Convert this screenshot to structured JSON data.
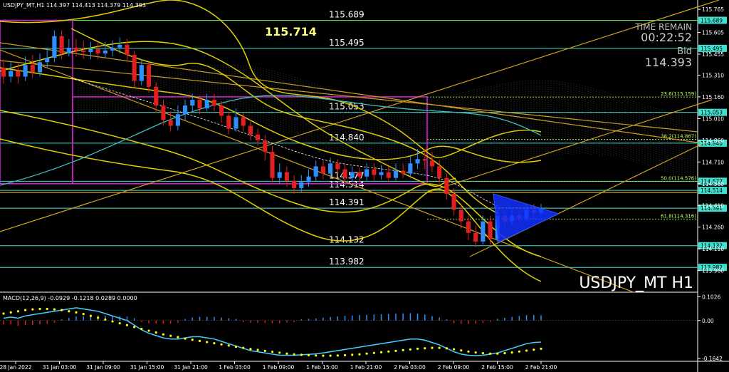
{
  "symbol_header": "USDJPY_MT,H1  114.397 114.413 114.379 114.393",
  "big_price": "115.714",
  "time_remain_label": "TIME REMAIN",
  "time_remain_value": "00:22:52",
  "bid_label": "Bid",
  "bid_value": "114.393",
  "watermark": "USDJPY_MT H1",
  "macd_header": "MACD(12,26,9) -0.0929 -0.1218 0.0289 0.0000",
  "colors": {
    "bull": "#2f8fff",
    "bear": "#e02020",
    "trend": "#e0c000",
    "level": "#40e0d0",
    "green_level": "#40ff40",
    "rect": "#e020e0",
    "signal": "#ffff00",
    "macd_line": "#40d0ff"
  },
  "chart_data": [
    {
      "type": "candlestick",
      "title": "USDJPY_MT,H1",
      "ylim": [
        113.85,
        115.78
      ],
      "y_ticks": [
        "115.765",
        "115.605",
        "115.455",
        "115.310",
        "115.160",
        "115.010",
        "114.860",
        "114.710",
        "114.560",
        "114.410",
        "114.260",
        "114.110",
        "113.960"
      ],
      "x_ticks": [
        "28 Jan 2022",
        "31 Jan 03:00",
        "31 Jan 09:00",
        "31 Jan 15:00",
        "31 Jan 21:00",
        "1 Feb 03:00",
        "1 Feb 09:00",
        "1 Feb 15:00",
        "1 Feb 21:00",
        "2 Feb 03:00",
        "2 Feb 09:00",
        "2 Feb 15:00",
        "2 Feb 21:00"
      ],
      "levels": [
        {
          "value": 115.689,
          "label": "115.689",
          "tag": "115.689"
        },
        {
          "value": 115.495,
          "label": "115.495",
          "tag": "115.495"
        },
        {
          "value": 115.053,
          "label": "115.053",
          "tag": "115.053"
        },
        {
          "value": 114.84,
          "label": "114.840",
          "tag": "114.840"
        },
        {
          "value": 114.577,
          "label": "114.577",
          "tag": "114.577"
        },
        {
          "value": 114.514,
          "label": "114.514",
          "tag": "114.514"
        },
        {
          "value": 114.391,
          "label": "114.391",
          "tag": "114.391"
        },
        {
          "value": 114.132,
          "label": "114.132",
          "tag": "114.132"
        },
        {
          "value": 113.982,
          "label": "113.982",
          "tag": "113.982"
        }
      ],
      "fibo": [
        {
          "value": 115.159,
          "label": "23.6(115.159)"
        },
        {
          "value": 114.867,
          "label": "38.2(114.867)"
        },
        {
          "value": 114.576,
          "label": "50.0(114.576)"
        },
        {
          "value": 114.316,
          "label": "61.8(114.316)"
        }
      ],
      "current_price": 114.393,
      "candles": [
        [
          115.36,
          115.3,
          115.42,
          115.25
        ],
        [
          115.3,
          115.34,
          115.4,
          115.26
        ],
        [
          115.34,
          115.3,
          115.39,
          115.25
        ],
        [
          115.3,
          115.38,
          115.44,
          115.27
        ],
        [
          115.38,
          115.33,
          115.45,
          115.29
        ],
        [
          115.33,
          115.4,
          115.46,
          115.3
        ],
        [
          115.4,
          115.43,
          115.5,
          115.36
        ],
        [
          115.43,
          115.58,
          115.62,
          115.4
        ],
        [
          115.58,
          115.46,
          115.62,
          115.42
        ],
        [
          115.46,
          115.5,
          115.56,
          115.44
        ],
        [
          115.5,
          115.48,
          115.56,
          115.44
        ],
        [
          115.48,
          115.47,
          115.55,
          115.42
        ],
        [
          115.47,
          115.49,
          115.54,
          115.42
        ],
        [
          115.49,
          115.46,
          115.54,
          115.42
        ],
        [
          115.46,
          115.48,
          115.54,
          115.43
        ],
        [
          115.48,
          115.5,
          115.55,
          115.44
        ],
        [
          115.5,
          115.52,
          115.57,
          115.46
        ],
        [
          115.52,
          115.45,
          115.56,
          115.4
        ],
        [
          115.45,
          115.27,
          115.48,
          115.23
        ],
        [
          115.27,
          115.38,
          115.42,
          115.24
        ],
        [
          115.38,
          115.23,
          115.4,
          115.19
        ],
        [
          115.23,
          115.1,
          115.26,
          115.05
        ],
        [
          115.1,
          115.0,
          115.14,
          114.96
        ],
        [
          115.0,
          114.96,
          115.06,
          114.92
        ],
        [
          114.96,
          115.04,
          115.1,
          114.93
        ],
        [
          115.04,
          115.1,
          115.14,
          115.0
        ],
        [
          115.1,
          115.14,
          115.18,
          115.06
        ],
        [
          115.14,
          115.08,
          115.17,
          115.04
        ],
        [
          115.08,
          115.14,
          115.18,
          115.06
        ],
        [
          115.14,
          115.1,
          115.18,
          115.06
        ],
        [
          115.1,
          115.03,
          115.13,
          114.98
        ],
        [
          115.03,
          114.94,
          115.06,
          114.9
        ],
        [
          114.94,
          115.02,
          115.08,
          114.92
        ],
        [
          115.02,
          114.96,
          115.05,
          114.92
        ],
        [
          114.96,
          114.9,
          115.0,
          114.86
        ],
        [
          114.9,
          114.86,
          114.94,
          114.82
        ],
        [
          114.86,
          114.78,
          114.9,
          114.72
        ],
        [
          114.78,
          114.6,
          114.82,
          114.56
        ],
        [
          114.6,
          114.64,
          114.7,
          114.56
        ],
        [
          114.64,
          114.58,
          114.68,
          114.54
        ],
        [
          114.58,
          114.53,
          114.62,
          114.49
        ],
        [
          114.53,
          114.57,
          114.62,
          114.5
        ],
        [
          114.57,
          114.61,
          114.66,
          114.54
        ],
        [
          114.61,
          114.68,
          114.72,
          114.58
        ],
        [
          114.68,
          114.63,
          114.72,
          114.59
        ],
        [
          114.63,
          114.7,
          114.74,
          114.6
        ],
        [
          114.7,
          114.66,
          114.73,
          114.62
        ],
        [
          114.66,
          114.6,
          114.7,
          114.56
        ],
        [
          114.6,
          114.64,
          114.68,
          114.57
        ],
        [
          114.64,
          114.61,
          114.67,
          114.57
        ],
        [
          114.61,
          114.66,
          114.7,
          114.58
        ],
        [
          114.66,
          114.62,
          114.7,
          114.58
        ],
        [
          114.62,
          114.64,
          114.69,
          114.59
        ],
        [
          114.64,
          114.6,
          114.68,
          114.57
        ],
        [
          114.6,
          114.65,
          114.7,
          114.58
        ],
        [
          114.65,
          114.63,
          114.7,
          114.6
        ],
        [
          114.63,
          114.7,
          114.75,
          114.61
        ],
        [
          114.7,
          114.73,
          114.8,
          114.66
        ],
        [
          114.73,
          114.72,
          114.8,
          114.66
        ],
        [
          114.72,
          114.68,
          114.78,
          114.64
        ],
        [
          114.68,
          114.6,
          114.72,
          114.56
        ],
        [
          114.6,
          114.49,
          114.63,
          114.45
        ],
        [
          114.49,
          114.38,
          114.53,
          114.34
        ],
        [
          114.38,
          114.3,
          114.42,
          114.25
        ],
        [
          114.3,
          114.22,
          114.34,
          114.17
        ],
        [
          114.22,
          114.16,
          114.27,
          114.12
        ],
        [
          114.16,
          114.3,
          114.34,
          114.14
        ],
        [
          114.3,
          114.18,
          114.34,
          114.14
        ],
        [
          114.18,
          114.34,
          114.38,
          114.16
        ],
        [
          114.34,
          114.3,
          114.38,
          114.26
        ],
        [
          114.3,
          114.34,
          114.38,
          114.27
        ],
        [
          114.34,
          114.32,
          114.38,
          114.28
        ],
        [
          114.32,
          114.38,
          114.42,
          114.3
        ],
        [
          114.38,
          114.36,
          114.42,
          114.32
        ],
        [
          114.36,
          114.39,
          114.42,
          114.34
        ]
      ]
    },
    {
      "type": "macd",
      "title": "MACD(12,26,9)",
      "params": [
        12,
        26,
        9
      ],
      "current": {
        "macd": -0.0929,
        "signal": -0.1218,
        "histogram": 0.0289,
        "extra": 0.0
      },
      "ylim": [
        -0.17,
        0.11
      ],
      "y_ticks": [
        "0.1026",
        "0.00",
        "-0.1642"
      ],
      "macd": [
        0.01,
        0.015,
        0.01,
        0.02,
        0.025,
        0.03,
        0.035,
        0.04,
        0.045,
        0.05,
        0.055,
        0.05,
        0.045,
        0.04,
        0.03,
        0.02,
        0.01,
        0.0,
        -0.02,
        -0.04,
        -0.055,
        -0.065,
        -0.075,
        -0.08,
        -0.08,
        -0.075,
        -0.07,
        -0.07,
        -0.075,
        -0.08,
        -0.09,
        -0.1,
        -0.11,
        -0.12,
        -0.13,
        -0.135,
        -0.14,
        -0.145,
        -0.15,
        -0.15,
        -0.15,
        -0.148,
        -0.146,
        -0.144,
        -0.14,
        -0.135,
        -0.13,
        -0.125,
        -0.12,
        -0.115,
        -0.11,
        -0.105,
        -0.1,
        -0.095,
        -0.09,
        -0.085,
        -0.08,
        -0.08,
        -0.085,
        -0.095,
        -0.105,
        -0.12,
        -0.135,
        -0.145,
        -0.15,
        -0.152,
        -0.15,
        -0.145,
        -0.14,
        -0.13,
        -0.12,
        -0.11,
        -0.1,
        -0.095,
        -0.093
      ],
      "signal": [
        0.03,
        0.035,
        0.04,
        0.045,
        0.048,
        0.05,
        0.05,
        0.048,
        0.045,
        0.04,
        0.035,
        0.028,
        0.02,
        0.012,
        0.004,
        -0.004,
        -0.012,
        -0.02,
        -0.028,
        -0.036,
        -0.044,
        -0.052,
        -0.06,
        -0.066,
        -0.072,
        -0.078,
        -0.083,
        -0.088,
        -0.093,
        -0.098,
        -0.103,
        -0.108,
        -0.113,
        -0.118,
        -0.123,
        -0.127,
        -0.131,
        -0.135,
        -0.139,
        -0.143,
        -0.146,
        -0.148,
        -0.15,
        -0.151,
        -0.152,
        -0.152,
        -0.151,
        -0.15,
        -0.148,
        -0.146,
        -0.143,
        -0.14,
        -0.137,
        -0.134,
        -0.131,
        -0.128,
        -0.125,
        -0.122,
        -0.12,
        -0.118,
        -0.118,
        -0.12,
        -0.124,
        -0.129,
        -0.134,
        -0.138,
        -0.141,
        -0.143,
        -0.143,
        -0.141,
        -0.138,
        -0.134,
        -0.13,
        -0.126,
        -0.122
      ]
    }
  ]
}
